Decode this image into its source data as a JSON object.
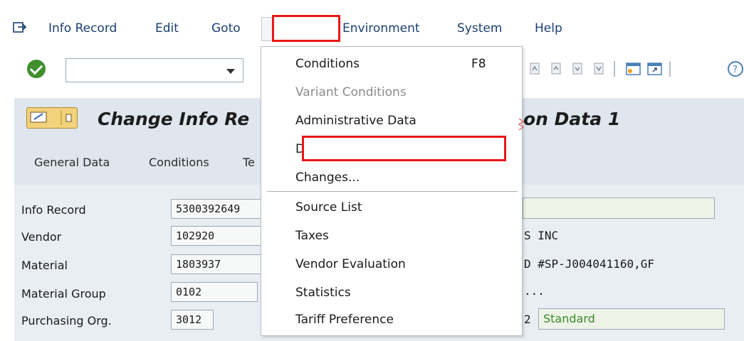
{
  "menubar": {
    "items": [
      "Info Record",
      "Edit",
      "Goto",
      "Environment",
      "System",
      "Help"
    ]
  },
  "toolbar": {
    "command_value": ""
  },
  "header": {
    "title_left": "Change Info Re",
    "title_right": "on Data 1"
  },
  "tabs": [
    "General Data",
    "Conditions",
    "Te"
  ],
  "fields": {
    "labels": [
      "Info Record",
      "Vendor",
      "Material",
      "Material Group",
      "Purchasing Org."
    ],
    "values": [
      "5300392649",
      "102920",
      "1803937",
      "0102",
      "3012"
    ],
    "right_texts": [
      "S INC",
      "D #SP-J004041160,GF",
      "...",
      "2"
    ],
    "standard_value": "Standard"
  },
  "dropdown": {
    "items": [
      {
        "label": "Conditions",
        "shortcut": "F8",
        "disabled": false
      },
      {
        "label": "Variant Conditions",
        "disabled": true
      },
      {
        "label": "Administrative Data",
        "disabled": false
      },
      {
        "label": "D",
        "disabled": false
      },
      {
        "label": "Changes...",
        "disabled": false
      },
      {
        "label": "Source List",
        "disabled": false
      },
      {
        "label": "Taxes",
        "disabled": false
      },
      {
        "label": "Vendor Evaluation",
        "disabled": false
      },
      {
        "label": "Statistics",
        "disabled": false
      },
      {
        "label": "Tariff Preference",
        "disabled": false
      }
    ]
  },
  "colors": {
    "highlight_box": "#e81717",
    "header_bg": "#dfe6ee",
    "ok_green": "#3f8f2e"
  },
  "icons": [
    "exit-icon",
    "check-icon",
    "dropdown-arrow-icon",
    "first-page-icon",
    "previous-page-icon",
    "next-page-icon",
    "last-page-icon",
    "new-session-icon",
    "shortcut-icon",
    "help-icon",
    "display-change-icon"
  ]
}
